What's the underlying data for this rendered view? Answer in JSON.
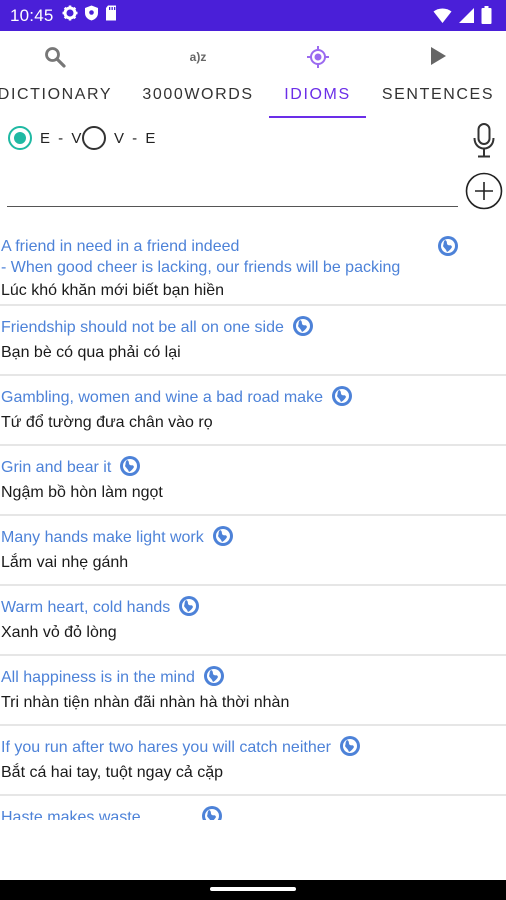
{
  "status": {
    "time": "10:45",
    "left_icons": [
      "gear-icon",
      "shield-icon",
      "sd-card-icon"
    ],
    "right_icons": [
      "wifi-icon",
      "signal-icon",
      "battery-icon"
    ],
    "bar_color": "#4a1fd8"
  },
  "tabs": [
    {
      "label": "DICTIONARY",
      "icon": "search-icon"
    },
    {
      "label": "3000WORDS",
      "icon": "a-z-icon",
      "icon_text": "a)z"
    },
    {
      "label": "IDIOMS",
      "icon": "target-icon",
      "active": true
    },
    {
      "label": "SENTENCES",
      "icon": "play-icon"
    }
  ],
  "accent_color": "#6b2ee8",
  "direction": {
    "option1": "E - V",
    "option2": "V - E",
    "selected": "E - V"
  },
  "search": {
    "value": ""
  },
  "idioms": [
    {
      "en": "A friend in need in a friend indeed",
      "en2": "- When good cheer is lacking, our friends will be packing",
      "vi": "Lúc khó khăn mới biết bạn hiền"
    },
    {
      "en": "Friendship should not be all on one side",
      "vi": "Bạn bè có qua phải có lại"
    },
    {
      "en": "Gambling, women and wine a bad road make",
      "vi": "Tứ đổ tường đưa chân vào rọ"
    },
    {
      "en": "Grin and bear it",
      "vi": "Ngậm bồ hòn làm ngọt"
    },
    {
      "en": "Many hands make light work",
      "vi": "Lắm vai nhẹ gánh"
    },
    {
      "en": "Warm heart, cold hands",
      "vi": "Xanh vỏ đỏ lòng"
    },
    {
      "en": "All happiness is in the mind",
      "vi": "Tri nhàn tiện nhàn đãi nhàn hà thời nhàn"
    },
    {
      "en": "If you run after two hares you will catch neither",
      "vi": "Bắt cá hai tay, tuột ngay cả cặp"
    },
    {
      "en": "Haste makes waste",
      "vi": ""
    }
  ]
}
